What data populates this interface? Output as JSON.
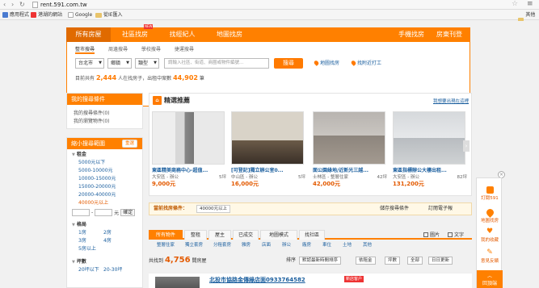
{
  "browser": {
    "url": "rent.591.com.tw",
    "bookmarks": [
      "應用程式",
      "港湖的網站",
      "Google",
      "從IE匯入"
    ],
    "other_bookmarks": "其他書"
  },
  "nav": {
    "items": [
      "所有房屋",
      "社區找房",
      "找經紀人",
      "地圖找房"
    ],
    "new_badge": "NEW",
    "right_items": [
      "手機找房",
      "房東刊登"
    ]
  },
  "search": {
    "tabs": [
      "整市搜尋",
      "周邊搜尋",
      "學校搜尋",
      "捷運搜尋"
    ],
    "city": "台北市",
    "region": "鄉鎮",
    "type": "類型",
    "keyword_placeholder": "請輸入社區、街道、商圈或物件編號...",
    "button": "搜尋",
    "map_link": "地圖找房",
    "nearby_link": "找附近打工",
    "online_prefix": "目前共有",
    "online_count": "2,444",
    "online_mid": "人在找房子，出租中案數",
    "listing_count": "44,902",
    "online_suffix": "筆"
  },
  "sidebar": {
    "my_search_title": "我的搜尋條件",
    "my_search_items": [
      "我的搜尋條件(0)",
      "我的瀏覽物件(0)"
    ],
    "narrow_title": "縮小搜尋範圍",
    "reset": "重選",
    "rent_title": "租金",
    "rent_options": [
      "5000元以下",
      "5000-10000元",
      "10000-15000元",
      "15000-20000元",
      "20000-40000元",
      "40000元以上"
    ],
    "range_to": "-",
    "range_unit": "元",
    "range_go": "確定",
    "rooms_title": "格局",
    "rooms": [
      "1房",
      "2房",
      "3房",
      "4房",
      "5房以上"
    ],
    "size_title": "坪數",
    "sizes": [
      "20坪以下",
      "20-30坪"
    ]
  },
  "featured": {
    "title": "精選推薦",
    "link": "我想要出現在這裡",
    "cards": [
      {
        "title": "東區精美商務中心-超值...",
        "area": "大安區 - 辦公",
        "size": "5坪",
        "price": "9,000元"
      },
      {
        "title": "[可登記]獨立辦公室0...",
        "area": "中山區 - 辦公",
        "size": "5坪",
        "price": "16,000元"
      },
      {
        "title": "面公園綠地/近新光三越...",
        "area": "士林區 - 整層住家",
        "size": "42坪",
        "price": "42,000元"
      },
      {
        "title": "東區指標辦公大樓出租...",
        "area": "大安區 - 辦公",
        "size": "82坪",
        "price": "131,200元"
      }
    ]
  },
  "conditions": {
    "label": "當前找房條件：",
    "tag": "40000元以上",
    "save": "儲存搜尋條件",
    "subscribe": "訂閱電子報"
  },
  "list_tabs": [
    "所有物件",
    "屋主",
    "屋主",
    "已成交",
    "地圖模式",
    "找社區"
  ],
  "list_tabs_real": [
    "所有物件",
    "整租",
    "屋主",
    "已成交",
    "地圖模式",
    "找社區"
  ],
  "view_modes": [
    "圖片",
    "文字"
  ],
  "sub_filters": [
    "整層住家",
    "獨立套房",
    "分租套房",
    "雅房",
    "店面",
    "辦公",
    "廠房",
    "車位",
    "土地",
    "其他"
  ],
  "result": {
    "prefix": "共找到",
    "count": "4,756",
    "suffix": "間房屋",
    "sort_label": "排序",
    "sort_value": "默認最新時間排序",
    "sort_opts": [
      "依租金",
      "坪數",
      "全部",
      "日日更新"
    ]
  },
  "listing": {
    "title": "北投市協路金傳綠店面0933764582",
    "hot": "新店客户"
  },
  "float": {
    "items": [
      "訂閱591",
      "地圖找房",
      "我的收藏",
      "意見反饋"
    ],
    "top": "回頂端"
  }
}
